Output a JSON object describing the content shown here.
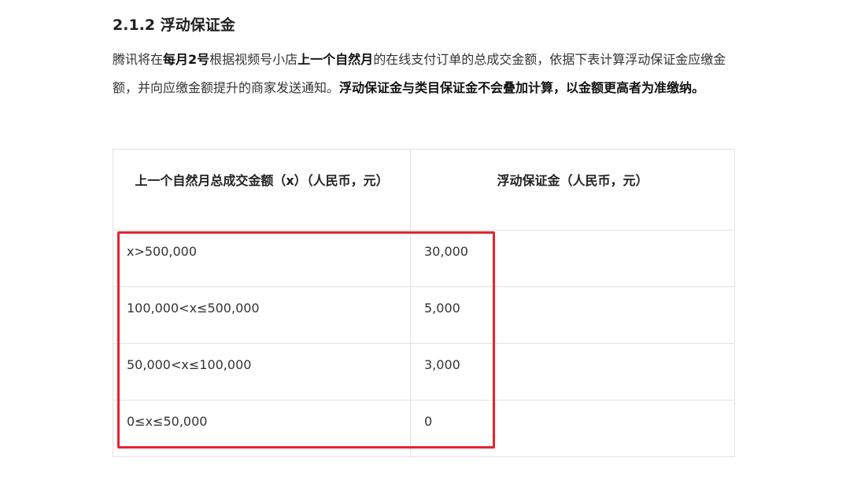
{
  "section": {
    "heading": "2.1.2 浮动保证金"
  },
  "intro": {
    "p1": "腾讯将在",
    "b1": "每月2号",
    "p2": "根据视频号小店",
    "b2": "上一个自然月",
    "p3": "的在线支付订单的总成交金额，依据下表计算浮动保证金应缴金额，并向应缴金额提升的商家发送通知。",
    "b3": "浮动保证金与类目保证金不会叠加计算，以金额更高者为准缴纳。"
  },
  "table": {
    "headers": [
      "上一个自然月总成交金额（x）（人民币，元）",
      "浮动保证金（人民币，元）"
    ],
    "rows": [
      {
        "range": "x>500,000",
        "deposit": "30,000"
      },
      {
        "range": "100,000<x≤500,000",
        "deposit": "5,000"
      },
      {
        "range": "50,000<x≤100,000",
        "deposit": "3,000"
      },
      {
        "range": "0≤x≤50,000",
        "deposit": "0"
      }
    ]
  },
  "annotation": {
    "highlight_color": "#e8232f"
  }
}
